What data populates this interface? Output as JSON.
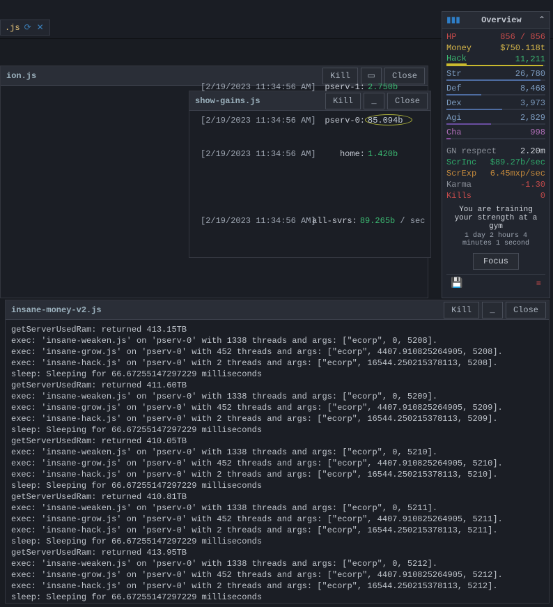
{
  "topbar": {
    "tab_label": ".js"
  },
  "back_panel": {
    "title": "ion.js",
    "kill": "Kill",
    "close": "Close"
  },
  "gains_panel": {
    "title": "show-gains.js",
    "kill": "Kill",
    "close": "Close",
    "lines": [
      {
        "ts": "[2/19/2023 11:34:56 AM]",
        "label": "pserv-1:",
        "val": "2.750b"
      },
      {
        "ts": "[2/19/2023 11:34:56 AM]",
        "label": "pserv-0:",
        "val": "85.094b",
        "highlight": true
      },
      {
        "ts": "[2/19/2023 11:34:56 AM]",
        "label": "home:",
        "val": "1.420b"
      }
    ],
    "total": {
      "ts": "[2/19/2023 11:34:56 AM]",
      "label": "all-svrs:",
      "val": "89.265b",
      "suffix": " / sec"
    }
  },
  "log_panel": {
    "title": "insane-money-v2.js",
    "kill": "Kill",
    "close": "Close",
    "text": "getServerUsedRam: returned 413.15TB\nexec: 'insane-weaken.js' on 'pserv-0' with 1338 threads and args: [\"ecorp\", 0, 5208].\nexec: 'insane-grow.js' on 'pserv-0' with 452 threads and args: [\"ecorp\", 4407.910825264905, 5208].\nexec: 'insane-hack.js' on 'pserv-0' with 2 threads and args: [\"ecorp\", 16544.250215378113, 5208].\nsleep: Sleeping for 66.67255147297229 milliseconds\ngetServerUsedRam: returned 411.60TB\nexec: 'insane-weaken.js' on 'pserv-0' with 1338 threads and args: [\"ecorp\", 0, 5209].\nexec: 'insane-grow.js' on 'pserv-0' with 452 threads and args: [\"ecorp\", 4407.910825264905, 5209].\nexec: 'insane-hack.js' on 'pserv-0' with 2 threads and args: [\"ecorp\", 16544.250215378113, 5209].\nsleep: Sleeping for 66.67255147297229 milliseconds\ngetServerUsedRam: returned 410.05TB\nexec: 'insane-weaken.js' on 'pserv-0' with 1338 threads and args: [\"ecorp\", 0, 5210].\nexec: 'insane-grow.js' on 'pserv-0' with 452 threads and args: [\"ecorp\", 4407.910825264905, 5210].\nexec: 'insane-hack.js' on 'pserv-0' with 2 threads and args: [\"ecorp\", 16544.250215378113, 5210].\nsleep: Sleeping for 66.67255147297229 milliseconds\ngetServerUsedRam: returned 410.81TB\nexec: 'insane-weaken.js' on 'pserv-0' with 1338 threads and args: [\"ecorp\", 0, 5211].\nexec: 'insane-grow.js' on 'pserv-0' with 452 threads and args: [\"ecorp\", 4407.910825264905, 5211].\nexec: 'insane-hack.js' on 'pserv-0' with 2 threads and args: [\"ecorp\", 16544.250215378113, 5211].\nsleep: Sleeping for 66.67255147297229 milliseconds\ngetServerUsedRam: returned 413.95TB\nexec: 'insane-weaken.js' on 'pserv-0' with 1338 threads and args: [\"ecorp\", 0, 5212].\nexec: 'insane-grow.js' on 'pserv-0' with 452 threads and args: [\"ecorp\", 4407.910825264905, 5212].\nexec: 'insane-hack.js' on 'pserv-0' with 2 threads and args: [\"ecorp\", 16544.250215378113, 5212].\nsleep: Sleeping for 66.67255147297229 milliseconds"
  },
  "overview": {
    "title": "Overview",
    "stats": {
      "hp": {
        "label": "HP",
        "value": "856 / 856",
        "bar": 100,
        "color": "#c24a4a"
      },
      "money": {
        "label": "Money",
        "value": "$750.118t"
      },
      "hack": {
        "label": "Hack",
        "value": "11,211",
        "bar": 98,
        "color": "#caba2e"
      },
      "str": {
        "label": "Str",
        "value": "26,780",
        "bar": 95,
        "color": "#4e6ca0"
      },
      "def": {
        "label": "Def",
        "value": "8,468",
        "bar": 35,
        "color": "#4e6ca0"
      },
      "dex": {
        "label": "Dex",
        "value": "3,973",
        "bar": 56,
        "color": "#4e6ca0"
      },
      "agi": {
        "label": "Agi",
        "value": "2,829",
        "bar": 45,
        "color": "#6a4ea0"
      },
      "cha": {
        "label": "Cha",
        "value": "998",
        "bar": 4,
        "color": "#8a4ea0"
      },
      "gn": {
        "label": "GN respect",
        "value": "2.20m"
      },
      "scri": {
        "label": "ScrInc",
        "value": "$89.27b/sec"
      },
      "scre": {
        "label": "ScrExp",
        "value": "6.45mxp/sec"
      },
      "karma": {
        "label": "Karma",
        "value": "-1.30"
      },
      "kills": {
        "label": "Kills",
        "value": "0"
      }
    },
    "msg": "You are training your strength at a gym",
    "sub": "1 day 2 hours 4 minutes 1 second",
    "focus": "Focus"
  }
}
